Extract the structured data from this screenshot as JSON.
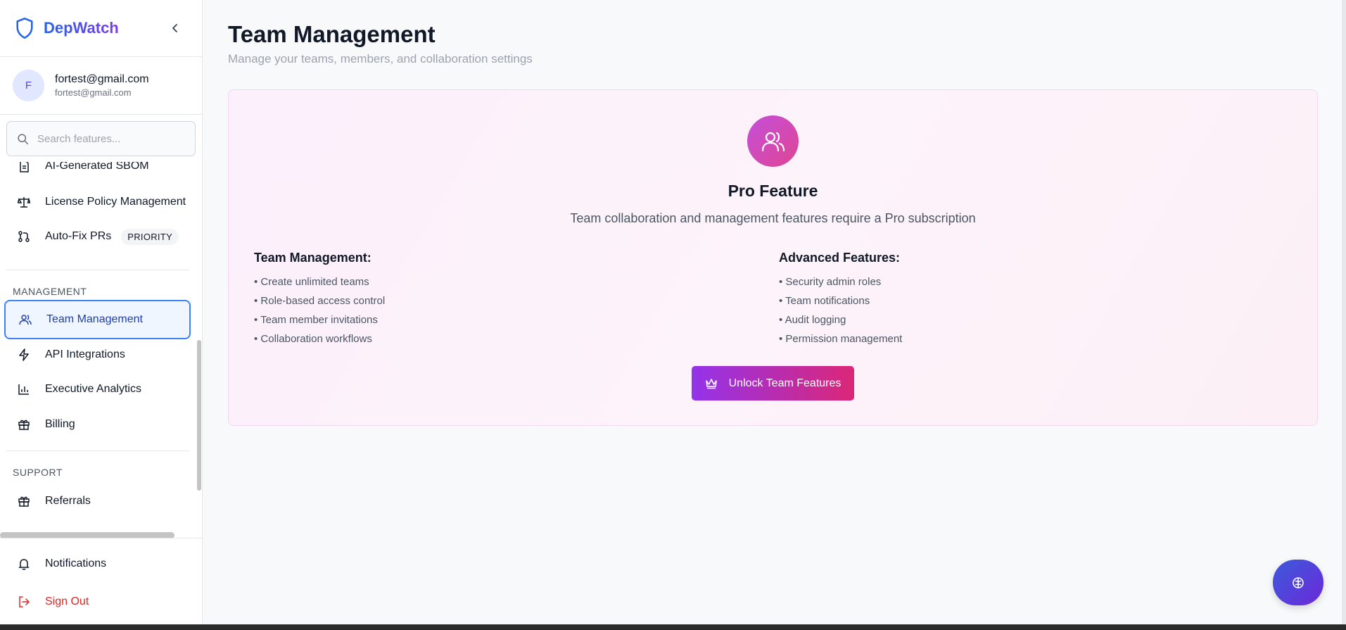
{
  "brand": {
    "name": "DepWatch"
  },
  "user": {
    "initial": "F",
    "email": "fortest@gmail.com",
    "sub_email": "fortest@gmail.com"
  },
  "search": {
    "placeholder": "Search features..."
  },
  "nav": {
    "items_top": [
      {
        "label": "AI-Generated SBOM",
        "icon": "document-icon"
      },
      {
        "label": "License Policy Management",
        "icon": "scale-icon"
      },
      {
        "label": "Auto-Fix PRs",
        "icon": "git-pull-request-icon",
        "badge": "PRIORITY"
      }
    ],
    "management_label": "MANAGEMENT",
    "management": [
      {
        "label": "Team Management",
        "icon": "users-icon",
        "active": true
      },
      {
        "label": "API Integrations",
        "icon": "zap-icon"
      },
      {
        "label": "Executive Analytics",
        "icon": "bar-chart-icon"
      },
      {
        "label": "Billing",
        "icon": "gift-icon"
      }
    ],
    "support_label": "SUPPORT",
    "support": [
      {
        "label": "Referrals",
        "icon": "gift-icon"
      }
    ],
    "bottom": [
      {
        "label": "Notifications",
        "icon": "bell-icon"
      },
      {
        "label": "Sign Out",
        "icon": "logout-icon"
      }
    ]
  },
  "page": {
    "title": "Team Management",
    "subtitle": "Manage your teams, members, and collaboration settings"
  },
  "pro": {
    "title": "Pro Feature",
    "description": "Team collaboration and management features require a Pro subscription",
    "left_heading": "Team Management:",
    "left_items": [
      "• Create unlimited teams",
      "• Role-based access control",
      "• Team member invitations",
      "• Collaboration workflows"
    ],
    "right_heading": "Advanced Features:",
    "right_items": [
      "• Security admin roles",
      "• Team notifications",
      "• Audit logging",
      "• Permission management"
    ],
    "cta_label": "Unlock Team Features"
  },
  "colors": {
    "accent": "#3b5bdb",
    "pro_gradient_start": "#9333ea",
    "pro_gradient_end": "#db2777",
    "danger": "#dc2626"
  }
}
